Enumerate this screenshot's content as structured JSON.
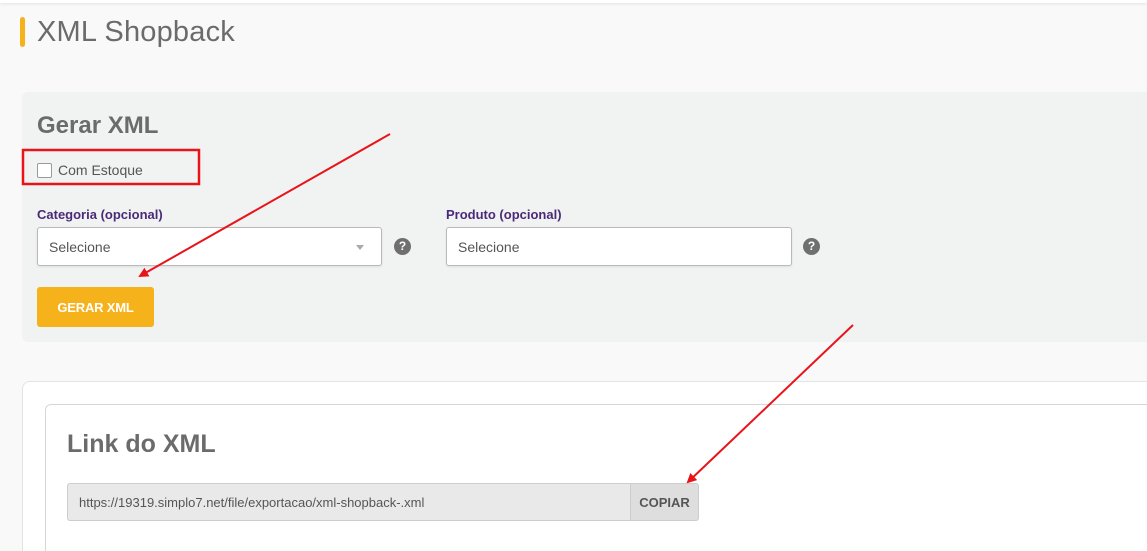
{
  "page": {
    "title": "XML Shopback"
  },
  "generate_section": {
    "title": "Gerar XML",
    "stock_checkbox": {
      "label": "Com Estoque",
      "checked": false
    },
    "category": {
      "label": "Categoria (opcional)",
      "value": "Selecione"
    },
    "product": {
      "label": "Produto (opcional)",
      "placeholder": "Selecione"
    },
    "help_glyph": "?",
    "button_label": "GERAR XML"
  },
  "link_section": {
    "title": "Link do XML",
    "url": "https://19319.simplo7.net/file/exportacao/xml-shopback-.xml",
    "copy_label": "COPIAR"
  },
  "colors": {
    "accent": "#f5b21a",
    "label_purple": "#4a2a78",
    "annotation_red": "#e8141a"
  }
}
